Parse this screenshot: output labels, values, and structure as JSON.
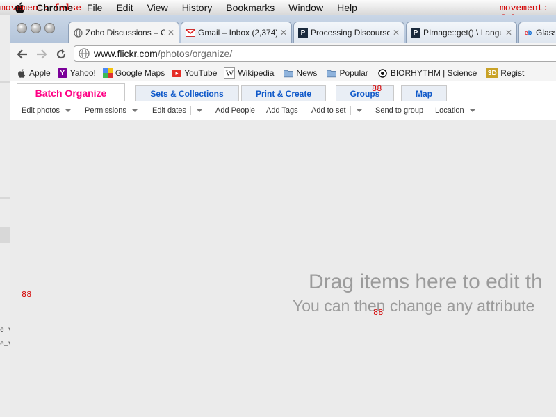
{
  "menubar": {
    "overlay_left": "movement: false",
    "app": "Chrome",
    "items": [
      "File",
      "Edit",
      "View",
      "History",
      "Bookmarks",
      "Window",
      "Help"
    ],
    "overlay_right": "movement: fal"
  },
  "left_window": {
    "lines": [
      "e_v",
      "e_v"
    ]
  },
  "tabs": [
    {
      "title": "Zoho Discussions – C",
      "icon": "globe-icon"
    },
    {
      "title": "Gmail – Inbox (2,374)",
      "icon": "gmail-icon"
    },
    {
      "title": "Processing Discourse",
      "icon": "processing-icon"
    },
    {
      "title": "PImage::get() \\ Langu",
      "icon": "processing-icon"
    },
    {
      "title": "Glass",
      "icon": "ebay-icon"
    }
  ],
  "address": {
    "host": "www.flickr.com",
    "path": "/photos/organize/"
  },
  "bookmarks": [
    {
      "label": "Apple",
      "icon": "apple-icon"
    },
    {
      "label": "Yahoo!",
      "icon": "yahoo-icon"
    },
    {
      "label": "Google Maps",
      "icon": "google-maps-icon"
    },
    {
      "label": "YouTube",
      "icon": "youtube-icon"
    },
    {
      "label": "Wikipedia",
      "icon": "wikipedia-icon"
    },
    {
      "label": "News",
      "icon": "folder-icon"
    },
    {
      "label": "Popular",
      "icon": "folder-icon"
    },
    {
      "label": "BIORHYTHM | Science",
      "icon": "biorhythm-icon"
    },
    {
      "label": "Regist",
      "icon": "3d-icon"
    }
  ],
  "flickr": {
    "tabs": [
      "Batch Organize",
      "Sets & Collections",
      "Print & Create",
      "Groups",
      "Map"
    ],
    "actions": [
      "Edit photos",
      "Permissions",
      "Edit dates",
      "Add People",
      "Add Tags",
      "Add to set",
      "Send to group",
      "Location"
    ],
    "drop_title": "Drag items here to edit th",
    "drop_subtitle": "You can then change any attribute"
  },
  "debug_marks": [
    "88",
    "88",
    "88"
  ],
  "colors": {
    "flickr_pink": "#ff0084",
    "flickr_blue": "#1059c9",
    "debug_red": "#d40000"
  }
}
